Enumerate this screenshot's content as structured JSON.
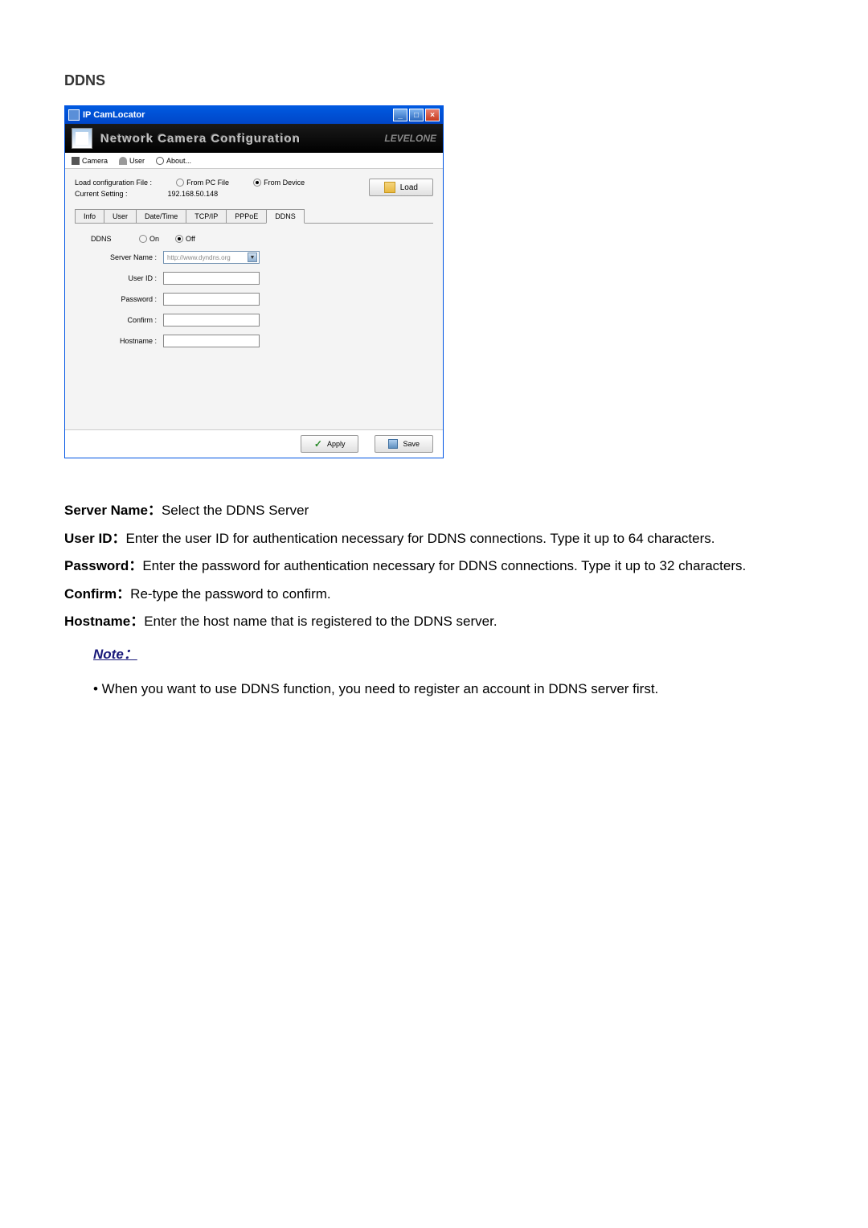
{
  "section_title": "DDNS",
  "window": {
    "title": "IP CamLocator",
    "banner_title": "Network Camera Configuration",
    "banner_brand": "LEVELONE"
  },
  "toolbar": {
    "camera": "Camera",
    "user": "User",
    "about": "About..."
  },
  "load": {
    "label1": "Load configuration File :",
    "label2": "Current Setting :",
    "from_pc": "From PC File",
    "from_device": "From Device",
    "ip": "192.168.50.148",
    "button": "Load"
  },
  "tabs": [
    "Info",
    "User",
    "Date/Time",
    "TCP/IP",
    "PPPoE",
    "DDNS"
  ],
  "form": {
    "ddns_label": "DDNS",
    "on": "On",
    "off": "Off",
    "server_name": "Server Name :",
    "server_value": "http://www.dyndns.org",
    "user_id": "User ID :",
    "password": "Password :",
    "confirm": "Confirm :",
    "hostname": "Hostname :"
  },
  "footer": {
    "apply": "Apply",
    "save": "Save"
  },
  "doc": {
    "server_name_label": "Server Name",
    "server_name_text": "Select the DDNS Server",
    "user_id_label": "User ID",
    "user_id_text": "Enter the user ID for authentication necessary for DDNS connections. Type it up to 64 characters.",
    "password_label": "Password",
    "password_text": "Enter the password for authentication necessary for DDNS connections. Type it up to 32 characters.",
    "confirm_label": "Confirm",
    "confirm_text": "Re-type the password to confirm.",
    "hostname_label": "Hostname",
    "hostname_text": "Enter the host name that is registered to the DDNS server.",
    "note_heading": "Note：",
    "note_bullet": "• When you want to use DDNS function, you need to register an account in DDNS server first."
  }
}
